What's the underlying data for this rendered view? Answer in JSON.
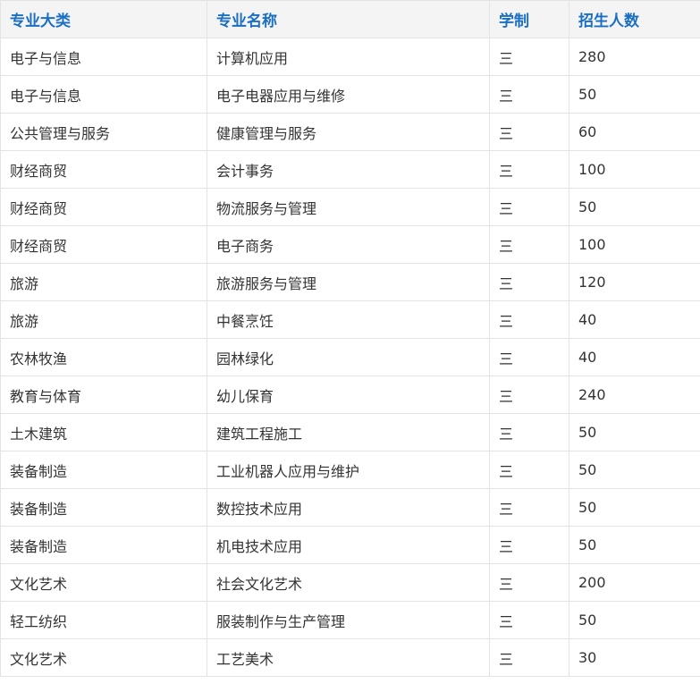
{
  "table": {
    "headers": [
      "专业大类",
      "专业名称",
      "学制",
      "招生人数"
    ],
    "rows": [
      [
        "电子与信息",
        "计算机应用",
        "三",
        "280"
      ],
      [
        "电子与信息",
        "电子电器应用与维修",
        "三",
        "50"
      ],
      [
        "公共管理与服务",
        "健康管理与服务",
        "三",
        "60"
      ],
      [
        "财经商贸",
        "会计事务",
        "三",
        "100"
      ],
      [
        "财经商贸",
        "物流服务与管理",
        "三",
        "50"
      ],
      [
        "财经商贸",
        "电子商务",
        "三",
        "100"
      ],
      [
        "旅游",
        "旅游服务与管理",
        "三",
        "120"
      ],
      [
        "旅游",
        "中餐烹饪",
        "三",
        "40"
      ],
      [
        "农林牧渔",
        "园林绿化",
        "三",
        "40"
      ],
      [
        "教育与体育",
        "幼儿保育",
        "三",
        "240"
      ],
      [
        "土木建筑",
        "建筑工程施工",
        "三",
        "50"
      ],
      [
        "装备制造",
        "工业机器人应用与维护",
        "三",
        "50"
      ],
      [
        "装备制造",
        "数控技术应用",
        "三",
        "50"
      ],
      [
        "装备制造",
        "机电技术应用",
        "三",
        "50"
      ],
      [
        "文化艺术",
        "社会文化艺术",
        "三",
        "200"
      ],
      [
        "轻工纺织",
        "服装制作与生产管理",
        "三",
        "50"
      ],
      [
        "文化艺术",
        "工艺美术",
        "三",
        "30"
      ]
    ]
  },
  "colors": {
    "header_text": "#1a6fc4",
    "header_background": "#f4f4f4",
    "body_text": "#333333",
    "border": "#e3e3e3"
  }
}
